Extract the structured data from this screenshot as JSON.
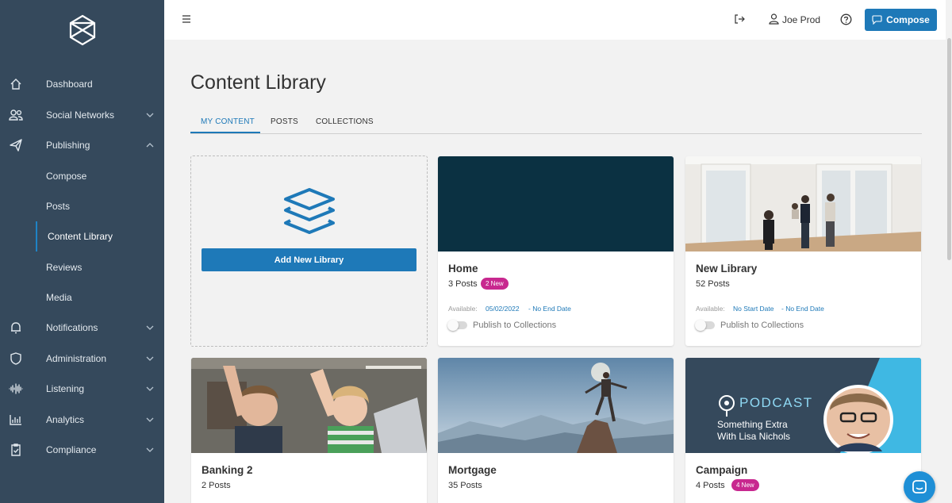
{
  "sidebar": {
    "items": [
      {
        "label": "Dashboard",
        "icon": "home-icon"
      },
      {
        "label": "Social Networks",
        "icon": "users-icon"
      },
      {
        "label": "Publishing",
        "icon": "paper-plane-icon"
      },
      {
        "label": "Compose"
      },
      {
        "label": "Posts"
      },
      {
        "label": "Content Library"
      },
      {
        "label": "Reviews"
      },
      {
        "label": "Media"
      },
      {
        "label": "Notifications",
        "icon": "bell-icon"
      },
      {
        "label": "Administration",
        "icon": "shield-icon"
      },
      {
        "label": "Listening",
        "icon": "soundwave-icon"
      },
      {
        "label": "Analytics",
        "icon": "bar-chart-icon"
      },
      {
        "label": "Compliance",
        "icon": "clipboard-check-icon"
      }
    ]
  },
  "header": {
    "user_name": "Joe Prod",
    "compose_label": "Compose"
  },
  "page": {
    "title": "Content Library",
    "tabs": [
      {
        "label": "MY CONTENT",
        "active": true
      },
      {
        "label": "POSTS",
        "active": false
      },
      {
        "label": "COLLECTIONS",
        "active": false
      }
    ]
  },
  "add_card": {
    "button_label": "Add New Library"
  },
  "cards": [
    {
      "title": "Home",
      "count": "3 Posts",
      "badge": "2 New",
      "available_label": "Available:",
      "available_start": "05/02/2022",
      "available_end": "- No End Date",
      "toggle_label": "Publish to Collections",
      "thumb_color": "#0b3142"
    },
    {
      "title": "New Library",
      "count": "52 Posts",
      "available_label": "Available:",
      "available_start": "No Start Date",
      "available_end": "- No End Date",
      "toggle_label": "Publish to Collections"
    },
    {
      "title": "Banking 2",
      "count": "2 Posts"
    },
    {
      "title": "Mortgage",
      "count": "35 Posts"
    },
    {
      "title": "Campaign",
      "count": "4 Posts",
      "badge": "4 New",
      "podcast_word": "PODCAST",
      "podcast_line1": "Something Extra",
      "podcast_line2": "With Lisa Nichols"
    }
  ],
  "colors": {
    "sidebar_bg": "#35495c",
    "accent": "#1e79b8",
    "badge": "#c8288f"
  }
}
